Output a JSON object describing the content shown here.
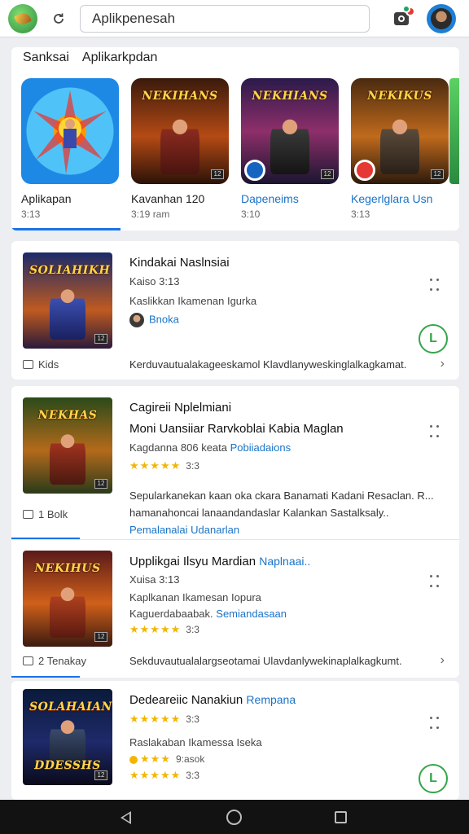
{
  "topbar": {
    "search_value": "Aplikpenesah",
    "logo_icon": "leaf-logo-icon",
    "refresh_icon": "refresh-icon",
    "camera_icon": "camera-icon",
    "avatar_icon": "profile-avatar"
  },
  "featured": {
    "heading_1": "Sanksai",
    "heading_2": "Aplikarkpdan",
    "tiles": [
      {
        "name": "Aplikapan",
        "sub": "3:13",
        "title_art": "",
        "name_blue": false
      },
      {
        "name": "Kavanhan 120",
        "sub": "3:19 ram",
        "title_art": "NEKIHANS",
        "name_blue": false
      },
      {
        "name": "Dapeneims",
        "sub": "3:10",
        "title_art": "NEKHIANS",
        "name_blue": true
      },
      {
        "name": "Kegerlglara Usn",
        "sub": "3:13",
        "title_art": "NEKIKUS",
        "name_blue": true
      }
    ]
  },
  "cards": [
    {
      "title": "Kindakai Naslnsiai",
      "line1": "Kaiso 3:13",
      "line2": "Kaslikkan Ikamenan Igurka",
      "author": "Bnoka",
      "cover_art": "SOLIAHIKH",
      "footer_left": "Kids",
      "footer_text": "Kerduvautualakageeskamol Klavdlanyweskinglalkagkamat.",
      "install_label": "L"
    },
    {
      "title": "Cagireii Nplelmiani",
      "line1": "Moni Uansiiar Rarvkoblai Kabia Maglan",
      "line2_a": "Kagdanna 806 keata",
      "line2_link": "Pobiiadaions",
      "rating": "★★★★★",
      "rating_count": "3:3",
      "cover_art": "NEKHAS",
      "footer_left": "1 Bolk",
      "desc_1": "Sepularkanekan kaan oka ckara Banamati Kadani Resaclan. R...",
      "desc_2": "hamanahoncai lanaandandaslar Kalankan Sastalksaly..",
      "desc_link": "Pemalanalai Udanarlan"
    },
    {
      "title": "Upplikgai Ilsyu Mardian",
      "title_link": "Naplnaai..",
      "line1": "Xuisa 3:13",
      "line2": "Kaplkanan Ikamesan Iopura",
      "line3_a": "Kaguerdabaabak.",
      "line3_link": "Semiandasaan",
      "rating": "★★★★★",
      "rating_count": "3:3",
      "cover_art": "NEKIHUS",
      "footer_left": "2 Tenakay",
      "footer_text": "Sekduvautualalargseotamai Ulavdanlywekinaplalkagkumt."
    },
    {
      "title": "Dedeareiic Nanakiun",
      "title_link": "Rempana",
      "rating": "★★★★★",
      "rating_count": "3:3",
      "line2": "Raslakaban Ikamessa Iseka",
      "rating2": "★★★",
      "rating2_text": "9:asok",
      "rating3": "★★★★★",
      "rating3_count": "3:3",
      "cover_art": "SOLAHAIAN",
      "cover_art_bottom": "DDESSHS",
      "install_label": "L"
    }
  ]
}
